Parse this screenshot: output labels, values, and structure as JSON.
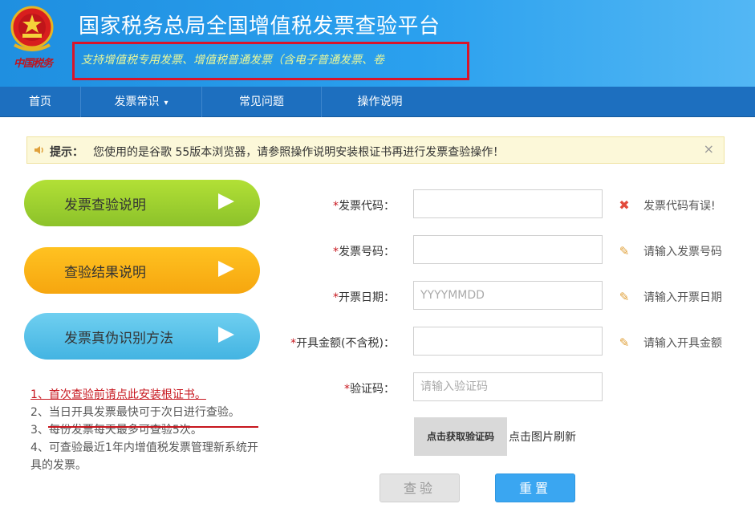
{
  "header": {
    "title": "国家税务总局全国增值税发票查验平台",
    "subtitle": "支持增值税专用发票、增值税普通发票（含电子普通发票、卷",
    "brand": "中国税务",
    "emblem_icon": "national-emblem-icon"
  },
  "nav": {
    "items": [
      {
        "label": "首页"
      },
      {
        "label": "发票常识",
        "caret": "▾"
      },
      {
        "label": "常见问题"
      },
      {
        "label": "操作说明"
      }
    ]
  },
  "notice": {
    "icon": "speaker-icon",
    "label": "提示：",
    "text": "您使用的是谷歌 55版本浏览器，请参照操作说明安装根证书再进行发票查验操作！",
    "close": "×"
  },
  "sidebar": {
    "buttons": [
      {
        "label": "发票查验说明",
        "color": "#9ccf2f"
      },
      {
        "label": "查验结果说明",
        "color": "#f8b114"
      },
      {
        "label": "发票真伪识别方法",
        "color": "#58c2ea"
      }
    ],
    "notes": [
      "1、首次查验前请点此安装根证书。",
      "2、当日开具发票最快可于次日进行查验。",
      "3、每份发票每天最多可查验5次。",
      "4、可查验最近1年内增值税发票管理新系统开具的发票。"
    ]
  },
  "form": {
    "fields": [
      {
        "required": "*",
        "label": "发票代码：",
        "value": "",
        "placeholder": "",
        "hint_icon": "error-x-icon",
        "hint": "发票代码有误!"
      },
      {
        "required": "*",
        "label": "发票号码：",
        "value": "",
        "placeholder": "",
        "hint_icon": "pencil-icon",
        "hint": "请输入发票号码"
      },
      {
        "required": "*",
        "label": "开票日期：",
        "value": "",
        "placeholder": "YYYYMMDD",
        "hint_icon": "pencil-icon",
        "hint": "请输入开票日期"
      },
      {
        "required": "*",
        "label": "开具金额(不含税)：",
        "value": "",
        "placeholder": "",
        "hint_icon": "pencil-icon",
        "hint": "请输入开具金额"
      },
      {
        "required": "*",
        "label": "验证码：",
        "value": "",
        "placeholder": "请输入验证码"
      }
    ],
    "captcha_image_text": "点击获取验证码",
    "captcha_refresh": "点击图片刷新",
    "check_button": "查验",
    "reset_button": "重置"
  },
  "colors": {
    "header": "#2a9ae8",
    "nav": "#1d6fbf",
    "accent_red": "#c7161e",
    "reset_button": "#3aa6f1"
  }
}
